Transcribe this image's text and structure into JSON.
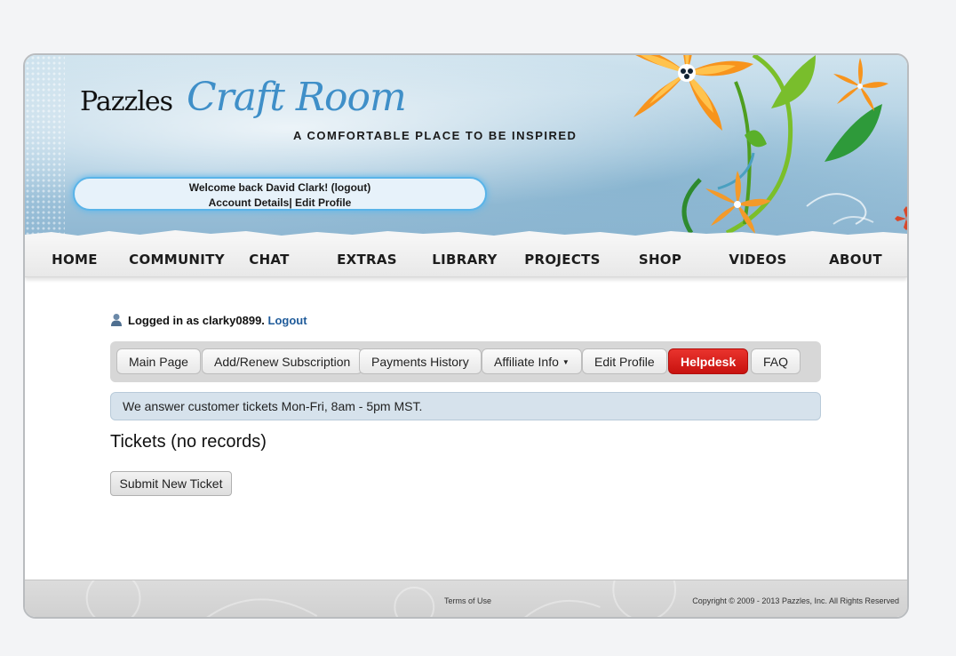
{
  "header": {
    "logo_brand": "Pazzles",
    "logo_title": "Craft Room",
    "tagline": "A COMFORTABLE PLACE TO BE INSPIRED",
    "welcome_text": "Welcome back David Clark!",
    "logout_link": "(logout)",
    "account_details": "Account Details",
    "separator": "|",
    "edit_profile": "Edit Profile"
  },
  "nav": {
    "items": [
      {
        "label": "HOME"
      },
      {
        "label": "COMMUNITY"
      },
      {
        "label": "CHAT"
      },
      {
        "label": "EXTRAS"
      },
      {
        "label": "LIBRARY"
      },
      {
        "label": "PROJECTS"
      },
      {
        "label": "SHOP"
      },
      {
        "label": "VIDEOS"
      },
      {
        "label": "ABOUT"
      }
    ]
  },
  "status": {
    "prefix": "Logged in as clarky0899.",
    "logout": "Logout"
  },
  "tabs": [
    {
      "label": "Main Page",
      "active": false
    },
    {
      "label": "Add/Renew Subscription",
      "active": false
    },
    {
      "label": "Payments History",
      "active": false
    },
    {
      "label": "Affiliate Info",
      "active": false,
      "dropdown": true
    },
    {
      "label": "Edit Profile",
      "active": false
    },
    {
      "label": "Helpdesk",
      "active": true
    },
    {
      "label": "FAQ",
      "active": false
    }
  ],
  "notice": "We answer customer tickets Mon-Fri, 8am - 5pm MST.",
  "tickets_title": "Tickets (no records)",
  "submit_button": "Submit New Ticket",
  "footer": {
    "terms": "Terms of Use",
    "copyright": "Copyright © 2009 - 2013 Pazzles, Inc. All Rights Reserved"
  },
  "colors": {
    "accent_blue": "#3f8fc8",
    "active_tab": "#d7201c",
    "link": "#1f5b9a"
  },
  "icons": [
    "user-icon",
    "caret-down-icon",
    "flower-decoration"
  ]
}
